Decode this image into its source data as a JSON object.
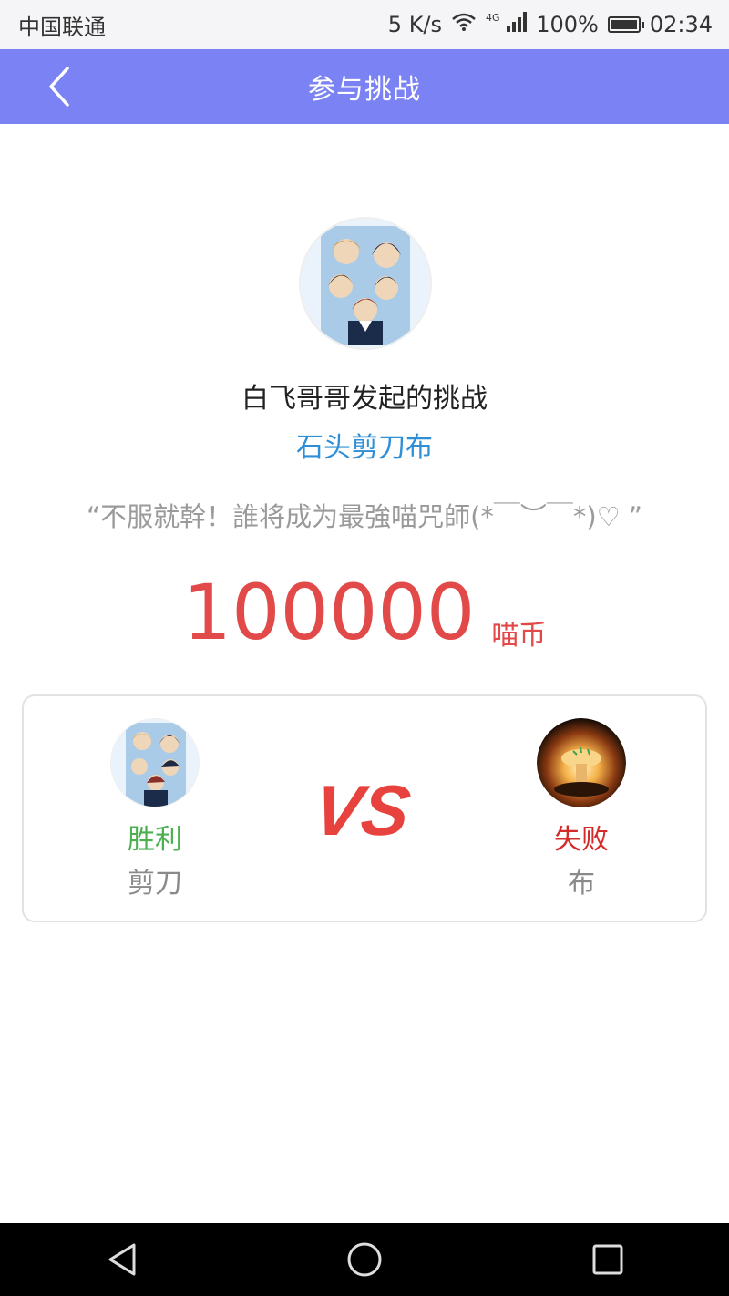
{
  "status_bar": {
    "carrier": "中国联通",
    "speed": "5 K/s",
    "network": "4G",
    "battery": "100%",
    "time": "02:34"
  },
  "nav": {
    "title": "参与挑战",
    "back_icon": "chevron-left-icon"
  },
  "challenge": {
    "challenger_title": "白飞哥哥发起的挑战",
    "game_name": "石头剪刀布",
    "quote": "“不服就幹！誰将成为最強喵咒師(*￣︶￣*)♡ ”",
    "amount": "100000",
    "unit": "喵币"
  },
  "vs_card": {
    "vs_label": "VS",
    "left_player": {
      "result": "胜利",
      "move": "剪刀"
    },
    "right_player": {
      "result": "失败",
      "move": "布"
    }
  },
  "colors": {
    "nav_bg": "#7b82f3",
    "game_name": "#2f8fd6",
    "amount": "#e24a4a",
    "win": "#4caf50",
    "lose": "#d42a2a",
    "vs": "#e8423e"
  },
  "system_nav": [
    "back-triangle-icon",
    "home-circle-icon",
    "recents-square-icon"
  ]
}
